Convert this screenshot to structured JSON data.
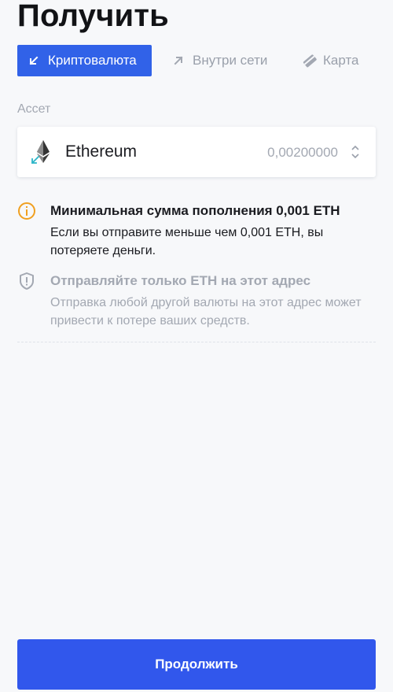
{
  "page": {
    "title": "Получить"
  },
  "tabs": [
    {
      "label": "Криптовалюта",
      "icon": "arrow-down-left-icon",
      "active": true
    },
    {
      "label": "Внутри сети",
      "icon": "arrow-up-right-icon",
      "active": false
    },
    {
      "label": "Карта",
      "icon": "card-icon",
      "active": false
    }
  ],
  "asset": {
    "label": "Ассет",
    "name": "Ethereum",
    "amount": "0,00200000",
    "icon": "ethereum-receive-icon"
  },
  "notices": [
    {
      "icon": "info-circle-icon",
      "title": "Минимальная сумма пополнения 0,001 ETH",
      "text": "Если вы отправите меньше чем 0,001 ETH, вы потеряете деньги."
    },
    {
      "icon": "shield-alert-icon",
      "title": "Отправляйте только ETH на этот адрес",
      "text": "Отправка любой другой валюты на этот адрес может привести к потере ваших средств."
    }
  ],
  "actions": {
    "continue_label": "Продолжить"
  },
  "colors": {
    "accent": "#3162e8",
    "button": "#3157ec",
    "background": "#f7f8fa",
    "warning": "#f0a020",
    "muted": "#a3a8b2",
    "teal": "#2bb5c8"
  }
}
